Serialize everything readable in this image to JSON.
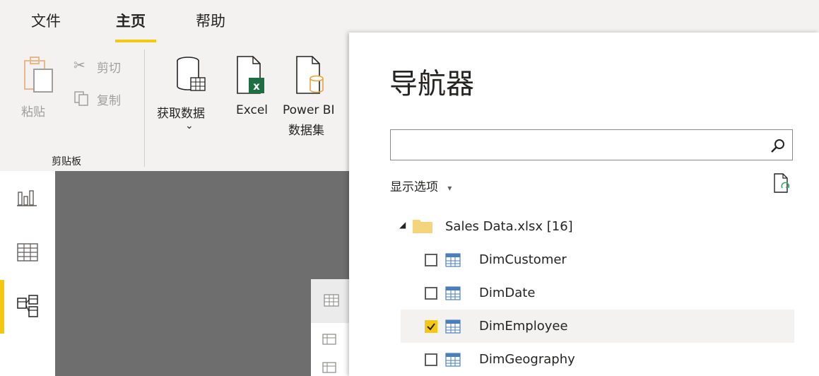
{
  "ribbon": {
    "tabs": [
      "文件",
      "主页",
      "帮助"
    ],
    "active_tab": "主页",
    "clipboard": {
      "paste_label": "粘贴",
      "cut_label": "剪切",
      "copy_label": "复制",
      "group_label": "剪贴板"
    },
    "data": {
      "get_data_label": "获取数据",
      "get_data_chevron": "⌄",
      "excel_label": "Excel",
      "powerbi_label_line1": "Power BI",
      "powerbi_label_line2": "数据集"
    }
  },
  "navigator": {
    "title": "导航器",
    "search_value": "",
    "display_options_label": "显示选项",
    "display_options_caret": "▾",
    "tree": {
      "root": {
        "label": "Sales Data.xlsx [16]",
        "expanded": true
      },
      "items": [
        {
          "label": "DimCustomer",
          "checked": false,
          "selected": false
        },
        {
          "label": "DimDate",
          "checked": false,
          "selected": false
        },
        {
          "label": "DimEmployee",
          "checked": true,
          "selected": true
        },
        {
          "label": "DimGeography",
          "checked": false,
          "selected": false
        }
      ]
    }
  },
  "colors": {
    "accent": "#f2c811",
    "excel_green": "#1d6f42",
    "folder": "#f4d47c",
    "table_icon_blue": "#4a7ebb"
  }
}
